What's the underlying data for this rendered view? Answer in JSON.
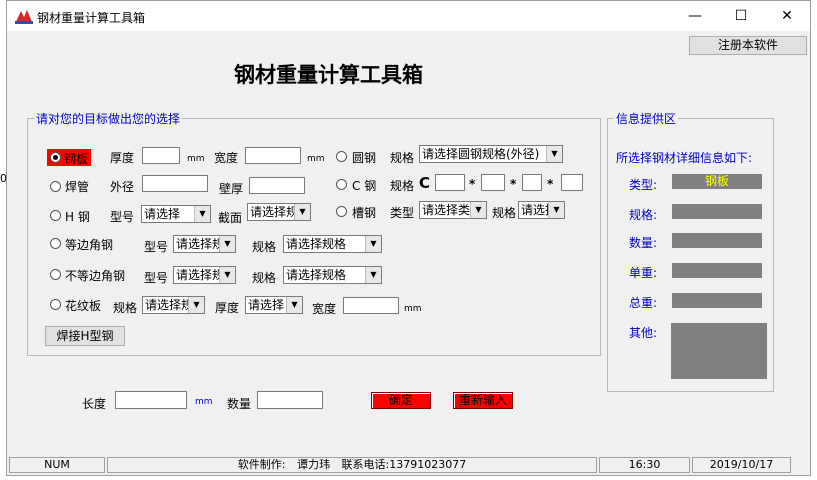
{
  "window": {
    "title": "钢材重量计算工具箱",
    "minimize": "—",
    "maximize": "☐",
    "close": "✕"
  },
  "register_button": "注册本软件",
  "heading": "钢材重量计算工具箱",
  "left_edge_char": "0",
  "selection_group": {
    "title": "请对您的目标做出您的选择",
    "steel_plate": {
      "label": "钢板",
      "thickness_label": "厚度",
      "thickness_unit": "mm",
      "width_label": "宽度",
      "width_unit": "mm"
    },
    "round_steel": {
      "label": "圆钢",
      "spec_label": "规格",
      "spec_select": "请选择圆钢规格(外径)"
    },
    "welded_pipe": {
      "label": "焊管",
      "outer_diameter_label": "外径",
      "wall_label": "壁厚"
    },
    "c_steel": {
      "label": "C 钢",
      "spec_label": "规格",
      "prefix": "C",
      "star": "*"
    },
    "h_steel": {
      "label": "H 钢",
      "model_label": "型号",
      "model_select": "请选择",
      "section_label": "截面",
      "section_select": "请选择规"
    },
    "channel_steel": {
      "label": "槽钢",
      "type_label": "类型",
      "type_select": "请选择类",
      "spec_label": "规格",
      "spec_select": "请选择"
    },
    "equal_angle": {
      "label": "等边角钢",
      "model_label": "型号",
      "model_select": "请选择规",
      "spec_label": "规格",
      "spec_select": "请选择规格"
    },
    "unequal_angle": {
      "label": "不等边角钢",
      "model_label": "型号",
      "model_select": "请选择规",
      "spec_label": "规格",
      "spec_select": "请选择规格"
    },
    "checker_plate": {
      "label": "花纹板",
      "spec_label": "规格",
      "spec_select": "请选择规",
      "thickness_label": "厚度",
      "thickness_select": "请选择",
      "width_label": "宽度",
      "width_unit": "mm"
    },
    "welded_h_button": "焊接H型钢"
  },
  "length_label": "长度",
  "length_unit": "mm",
  "quantity_label": "数量",
  "confirm_button": "确定",
  "reset_button": "重新输入",
  "info_group": {
    "title": "信息提供区",
    "subtitle": "所选择钢材详细信息如下:",
    "type_label": "类型:",
    "type_value": "钢板",
    "spec_label": "规格:",
    "quantity_label": "数量:",
    "unit_weight_label": "单重:",
    "total_weight_label": "总重:",
    "other_label": "其他:"
  },
  "status_bar": {
    "num": "NUM",
    "author_label": "软件制作:",
    "author": "谭力玮",
    "phone_label": "联系电话:",
    "phone": "13791023077",
    "time": "16:30",
    "date": "2019/10/17"
  },
  "colors": {
    "accent_red": "#ff0000",
    "label_blue": "#0000c8",
    "info_gray": "#808080",
    "type_value_yellow": "#ffff00"
  }
}
